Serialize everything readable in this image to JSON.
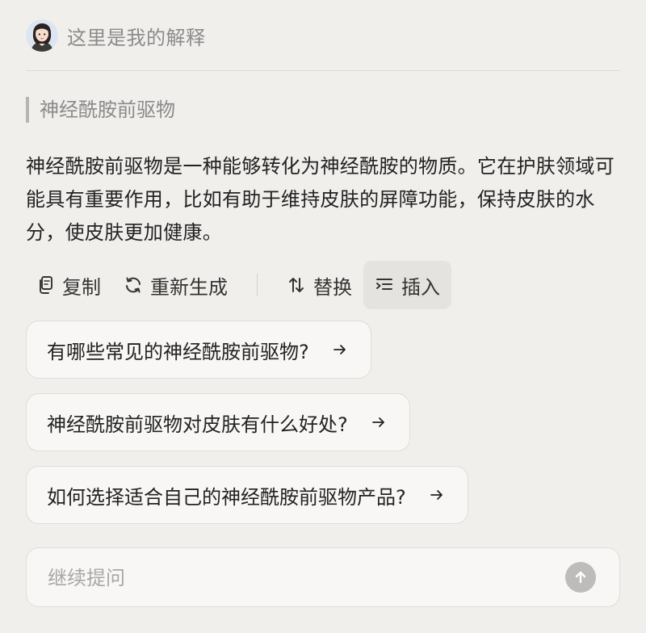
{
  "header": {
    "title": "这里是我的解释",
    "avatar_icon": "user-avatar-icon"
  },
  "quote": {
    "text": "神经酰胺前驱物"
  },
  "answer": {
    "text": "神经酰胺前驱物是一种能够转化为神经酰胺的物质。它在护肤领域可能具有重要作用，比如有助于维持皮肤的屏障功能，保持皮肤的水分，使皮肤更加健康。"
  },
  "toolbar": {
    "copy_label": "复制",
    "regenerate_label": "重新生成",
    "replace_label": "替换",
    "insert_label": "插入",
    "active_item": "insert"
  },
  "suggestions": [
    {
      "text": "有哪些常见的神经酰胺前驱物?"
    },
    {
      "text": "神经酰胺前驱物对皮肤有什么好处?"
    },
    {
      "text": "如何选择适合自己的神经酰胺前驱物产品?"
    }
  ],
  "input": {
    "placeholder": "继续提问",
    "value": ""
  },
  "colors": {
    "background": "#f1efec",
    "card": "#f8f7f5",
    "send_button": "#bdbcba",
    "active_tool": "#e5e3e0"
  }
}
